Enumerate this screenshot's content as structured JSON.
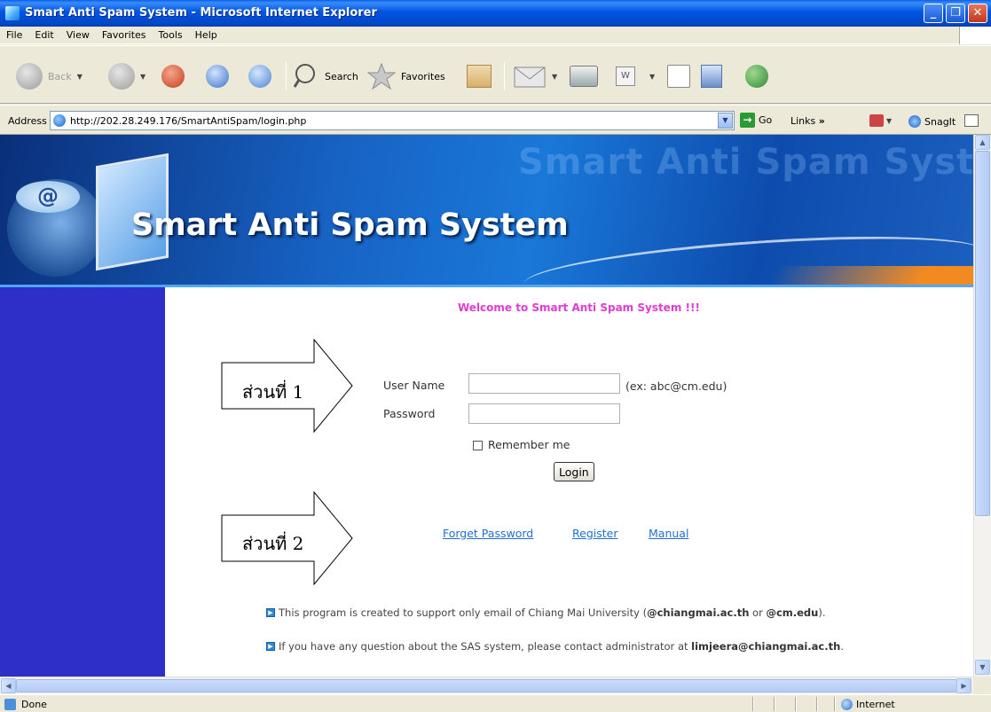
{
  "window": {
    "title": "Smart Anti Spam System - Microsoft Internet Explorer",
    "controls": [
      "_",
      "❐",
      "✕"
    ]
  },
  "menu": [
    "File",
    "Edit",
    "View",
    "Favorites",
    "Tools",
    "Help"
  ],
  "toolbar": {
    "back_label": "Back",
    "search_label": "Search",
    "favorites_label": "Favorites"
  },
  "address_bar": {
    "label": "Address",
    "url": "http://202.28.249.176/SmartAntiSpam/login.php",
    "go_label": "Go",
    "links_label": "Links",
    "snagit_label": "SnagIt"
  },
  "banner": {
    "title": "Smart Anti Spam System",
    "ghost_title": "Smart Anti Spam System",
    "at_symbol": "@"
  },
  "page": {
    "welcome": "Welcome to Smart Anti Spam System !!!",
    "part1_label": "ส่วนที่ 1",
    "part2_label": "ส่วนที่ 2",
    "username_label": "User Name",
    "username_value": "",
    "username_hint": "(ex: abc@cm.edu)",
    "password_label": "Password",
    "password_value": "",
    "remember_label": "Remember me",
    "login_button": "Login",
    "links": {
      "forget": "Forget Password",
      "register": "Register",
      "manual": "Manual"
    },
    "note1": {
      "prefix": "This program is created to support only email of Chiang Mai University (",
      "domain1": "@chiangmai.ac.th",
      "mid": " or ",
      "domain2": "@cm.edu",
      "suffix": ")."
    },
    "note2": {
      "prefix": "If you have any question about the SAS system, please contact administrator at ",
      "email": "limjeera@chiangmai.ac.th",
      "suffix": "."
    }
  },
  "status_bar": {
    "status": "Done",
    "zone": "Internet"
  },
  "colors": {
    "welcome": "#e03bd3",
    "sidebar": "#2e2ec8",
    "link": "#1f6fd6",
    "titlebar": "#0054e3"
  }
}
